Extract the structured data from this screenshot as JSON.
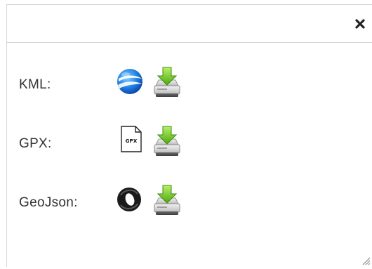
{
  "dialog": {
    "close_icon": "close-icon",
    "resize_icon": "resize-grip-icon",
    "exports": [
      {
        "label": "KML:",
        "format_icon": "google-earth-icon",
        "download_icon": "download-drive-icon"
      },
      {
        "label": "GPX:",
        "format_icon": "gpx-file-icon",
        "format_icon_text": "GPX",
        "download_icon": "download-drive-icon"
      },
      {
        "label": "GeoJson:",
        "format_icon": "geojson-icon",
        "download_icon": "download-drive-icon"
      }
    ]
  },
  "colors": {
    "border": "#d6d6d6",
    "label_text": "#333333",
    "download_arrow": "#6cc21c",
    "drive_body": "#d4d4d4"
  }
}
